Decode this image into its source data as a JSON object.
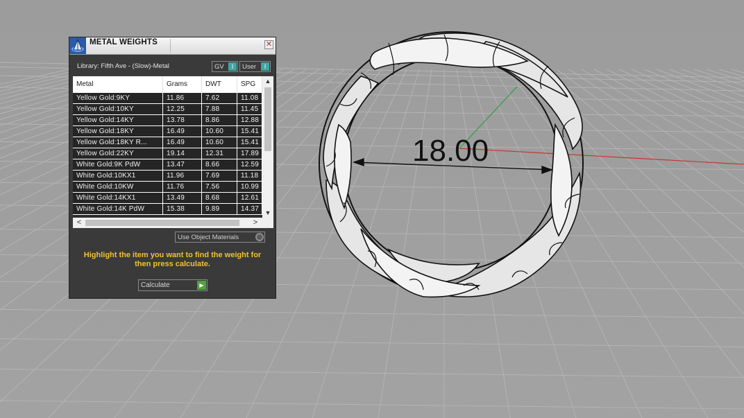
{
  "panel": {
    "title": "METAL WEIGHTS",
    "close_glyph": "✕",
    "library_label": "Library: Fifth Ave - (Slow)-Metal",
    "toggles": [
      {
        "label": "GV",
        "knob": "I"
      },
      {
        "label": "User",
        "knob": "I"
      }
    ],
    "table": {
      "columns": [
        "Metal",
        "Grams",
        "DWT",
        "SPG"
      ],
      "rows": [
        [
          "Yellow Gold:9KY",
          "11.86",
          "7.62",
          "11.08"
        ],
        [
          "Yellow Gold:10KY",
          "12.25",
          "7.88",
          "11.45"
        ],
        [
          "Yellow Gold:14KY",
          "13.78",
          "8.86",
          "12.88"
        ],
        [
          "Yellow Gold:18KY",
          "16.49",
          "10.60",
          "15.41"
        ],
        [
          "Yellow Gold:18KY R...",
          "16.49",
          "10.60",
          "15.41"
        ],
        [
          "Yellow Gold:22KY",
          "19.14",
          "12.31",
          "17.89"
        ],
        [
          "White Gold:9K PdW",
          "13.47",
          "8.66",
          "12.59"
        ],
        [
          "White Gold:10KX1",
          "11.96",
          "7.69",
          "11.18"
        ],
        [
          "White Gold:10KW",
          "11.76",
          "7.56",
          "10.99"
        ],
        [
          "White Gold:14KX1",
          "13.49",
          "8.68",
          "12.61"
        ],
        [
          "White Gold:14K PdW",
          "15.38",
          "9.89",
          "14.37"
        ]
      ]
    },
    "scroll_glyphs": {
      "up": "▲",
      "down": "▼",
      "left": "<",
      "right": ">"
    },
    "use_object_materials": "Use Object Materials",
    "instructions": "Highlight the item you want to find the weight for then press calculate.",
    "calculate_label": "Calculate",
    "calculate_knob": "▶"
  },
  "viewport": {
    "dimension_label": "18.00",
    "background_color": "#9a9a9a",
    "grid_color": "#b8b8b8",
    "x_axis_color": "#c0392b",
    "y_axis_color": "#2e9e3e"
  }
}
